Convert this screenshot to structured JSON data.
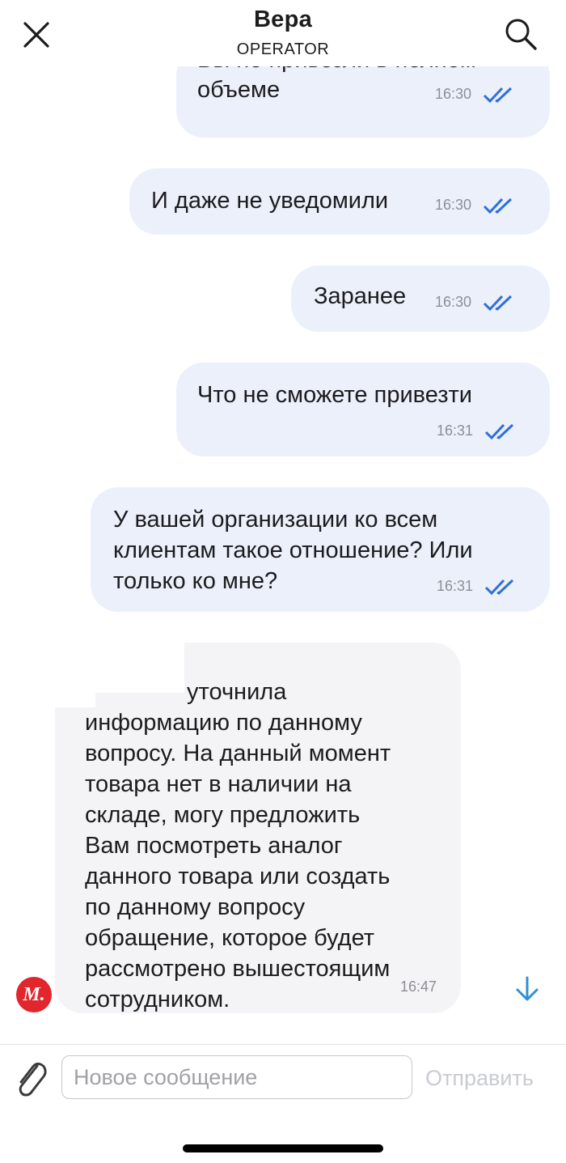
{
  "header": {
    "title": "Вера",
    "subtitle": "OPERATOR",
    "close_icon": "close-icon",
    "search_icon": "search-icon"
  },
  "messages": [
    {
      "lines": [
        "Вы не привезли в полном",
        "объеме"
      ],
      "time": "16:30",
      "status": "read"
    },
    {
      "lines": [
        "И даже не уведомили"
      ],
      "time": "16:30",
      "status": "read"
    },
    {
      "lines": [
        "Заранее"
      ],
      "time": "16:30",
      "status": "read"
    },
    {
      "lines": [
        "Что не сможете привезти"
      ],
      "time": "16:31",
      "status": "read"
    },
    {
      "lines": [
        "У вашей организации ко всем",
        "клиентам такое отношение? Или",
        "только ко мне?"
      ],
      "time": "16:31",
      "status": "read"
    }
  ],
  "incoming": {
    "first_line": "уточнила",
    "body": "информацию по данному\nвопросу. На данный момент\nтовара нет в наличии на\nскладе, могу предложить\nВам посмотреть аналог\nданного товара или создать\nпо данному вопросу\nобращение, которое будет\nрассмотрено вышестоящим\nсотрудником.",
    "time": "16:47",
    "avatar_letter": "М."
  },
  "composer": {
    "placeholder": "Новое сообщение",
    "send_label": "Отправить"
  },
  "colors": {
    "outgoing_bubble": "#ebf0fb",
    "incoming_bubble": "#f4f4f6",
    "check": "#2f6fd6",
    "avatar": "#e1262d",
    "send_disabled": "#c9cbd1"
  }
}
